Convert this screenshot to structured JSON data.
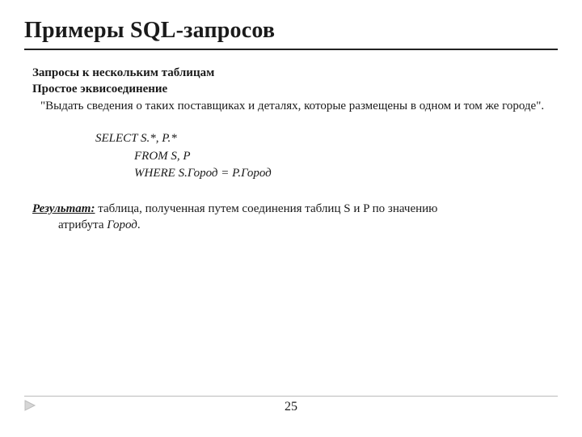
{
  "title": "Примеры SQL-запросов",
  "section": "Запросы к нескольким таблицам",
  "subsection": "Простое эквисоединение",
  "task": "\"Выдать сведения о таких поставщиках и деталях, которые размещены в одном и том же городе\".",
  "sql": {
    "line1": "SELECT  S.*,  P.*",
    "line2": "FROM   S, P",
    "line3": "WHERE  S.Город = P.Город"
  },
  "result_label": "Результат:",
  "result_text_1": " таблица, полученная путем соединения таблиц S и P по значению",
  "result_text_2_prefix": "атрибута ",
  "result_attr": "Город",
  "result_text_2_suffix": ".",
  "page_number": "25"
}
